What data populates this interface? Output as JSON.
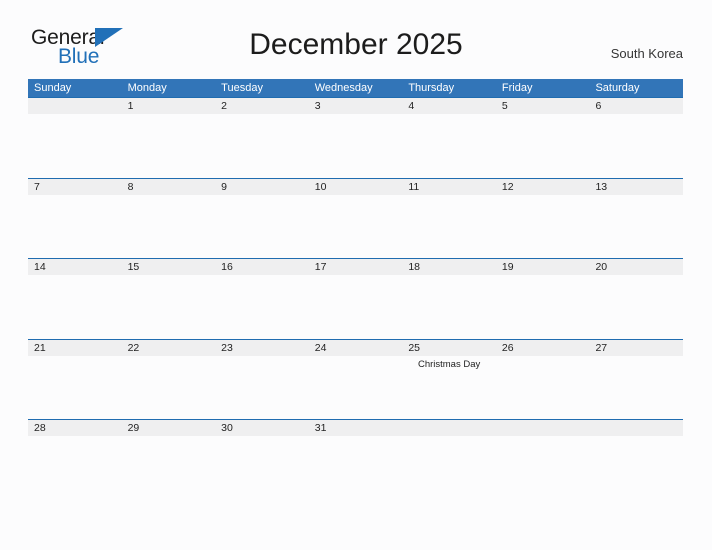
{
  "brand": {
    "word_one": "General",
    "word_two": "Blue",
    "triangle_icon": "triangle-right-icon",
    "colors": {
      "word_one": "#1c1c1c",
      "word_two": "#2170b8",
      "triangle": "#2170b8"
    }
  },
  "header": {
    "title": "December 2025",
    "region": "South Korea"
  },
  "theme": {
    "weekday_header_bg": "#3275b8",
    "weekday_header_text": "#ffffff",
    "date_band_bg": "#efeff0",
    "row_rule": "#1f6cb0",
    "page_bg": "#fcfcfd",
    "body_text": "#222222"
  },
  "calendar": {
    "weekdays": [
      "Sunday",
      "Monday",
      "Tuesday",
      "Wednesday",
      "Thursday",
      "Friday",
      "Saturday"
    ],
    "weeks": [
      {
        "days": [
          {
            "date": "",
            "event": ""
          },
          {
            "date": "1",
            "event": ""
          },
          {
            "date": "2",
            "event": ""
          },
          {
            "date": "3",
            "event": ""
          },
          {
            "date": "4",
            "event": ""
          },
          {
            "date": "5",
            "event": ""
          },
          {
            "date": "6",
            "event": ""
          }
        ]
      },
      {
        "days": [
          {
            "date": "7",
            "event": ""
          },
          {
            "date": "8",
            "event": ""
          },
          {
            "date": "9",
            "event": ""
          },
          {
            "date": "10",
            "event": ""
          },
          {
            "date": "11",
            "event": ""
          },
          {
            "date": "12",
            "event": ""
          },
          {
            "date": "13",
            "event": ""
          }
        ]
      },
      {
        "days": [
          {
            "date": "14",
            "event": ""
          },
          {
            "date": "15",
            "event": ""
          },
          {
            "date": "16",
            "event": ""
          },
          {
            "date": "17",
            "event": ""
          },
          {
            "date": "18",
            "event": ""
          },
          {
            "date": "19",
            "event": ""
          },
          {
            "date": "20",
            "event": ""
          }
        ]
      },
      {
        "days": [
          {
            "date": "21",
            "event": ""
          },
          {
            "date": "22",
            "event": ""
          },
          {
            "date": "23",
            "event": ""
          },
          {
            "date": "24",
            "event": ""
          },
          {
            "date": "25",
            "event": "Christmas Day"
          },
          {
            "date": "26",
            "event": ""
          },
          {
            "date": "27",
            "event": ""
          }
        ]
      },
      {
        "days": [
          {
            "date": "28",
            "event": ""
          },
          {
            "date": "29",
            "event": ""
          },
          {
            "date": "30",
            "event": ""
          },
          {
            "date": "31",
            "event": ""
          },
          {
            "date": "",
            "event": ""
          },
          {
            "date": "",
            "event": ""
          },
          {
            "date": "",
            "event": ""
          }
        ]
      }
    ]
  }
}
